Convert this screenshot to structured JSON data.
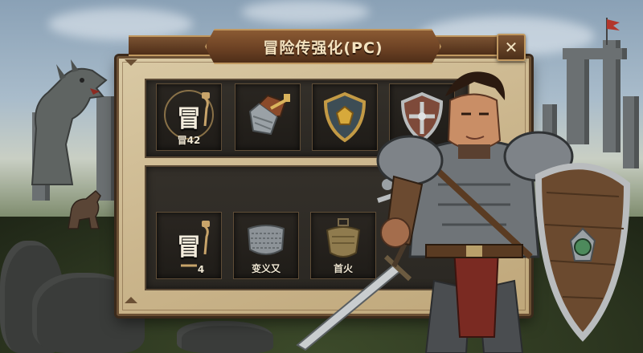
{
  "dialog": {
    "title": "冒险传强化(PC)",
    "close_glyph": "✕"
  },
  "top_row": [
    {
      "icon": "scroll-icon",
      "label": "冒",
      "count": "冒42"
    },
    {
      "icon": "bracer-icon",
      "label": "",
      "count": ""
    },
    {
      "icon": "golden-shield-icon",
      "label": "",
      "count": ""
    },
    {
      "icon": "silver-shield-icon",
      "label": "",
      "count": ""
    }
  ],
  "bottom_row": [
    {
      "icon": "scroll-icon",
      "label": "冒",
      "count": "4"
    },
    {
      "icon": "chainmail-icon",
      "label": "",
      "count": "变义又"
    },
    {
      "icon": "bronze-armor-icon",
      "label": "",
      "count": "首火"
    }
  ]
}
